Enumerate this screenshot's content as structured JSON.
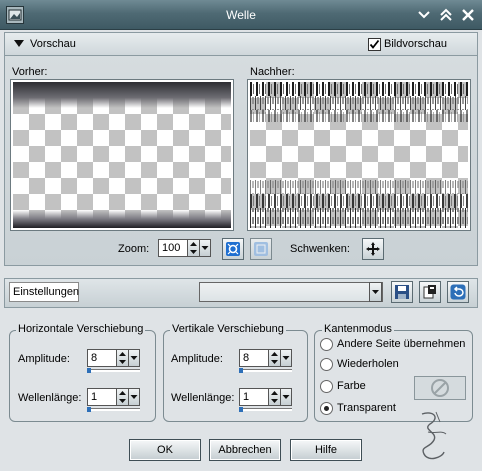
{
  "window": {
    "title": "Welle"
  },
  "titlebar_icons": {
    "app": "image-icon",
    "minimize": "chevron-down-icon",
    "maximize": "chevron-up-icon",
    "close": "close-icon"
  },
  "preview": {
    "section_label": "Vorschau",
    "toggle_label": "Bildvorschau",
    "toggle_checked": true,
    "before_label": "Vorher:",
    "after_label": "Nachher:",
    "zoom_label": "Zoom:",
    "zoom_value": "100",
    "pan_label": "Schwenken:"
  },
  "settings": {
    "label": "Einstellungen",
    "combo_value": ""
  },
  "horizontal": {
    "title": "Horizontale Verschiebung",
    "amplitude_label": "Amplitude:",
    "amplitude_value": "8",
    "wavelength_label": "Wellenlänge:",
    "wavelength_value": "1"
  },
  "vertical": {
    "title": "Vertikale Verschiebung",
    "amplitude_label": "Amplitude:",
    "amplitude_value": "8",
    "wavelength_label": "Wellenlänge:",
    "wavelength_value": "1"
  },
  "edge_mode": {
    "title": "Kantenmodus",
    "options": [
      "Andere Seite übernehmen",
      "Wiederholen",
      "Farbe",
      "Transparent"
    ],
    "selected": "Transparent"
  },
  "buttons": {
    "ok": "OK",
    "cancel": "Abbrechen",
    "help": "Hilfe"
  },
  "colors": {
    "titlebar": "#4f6a74",
    "accent": "#2d6fb8",
    "panel": "#dfe3e6"
  }
}
